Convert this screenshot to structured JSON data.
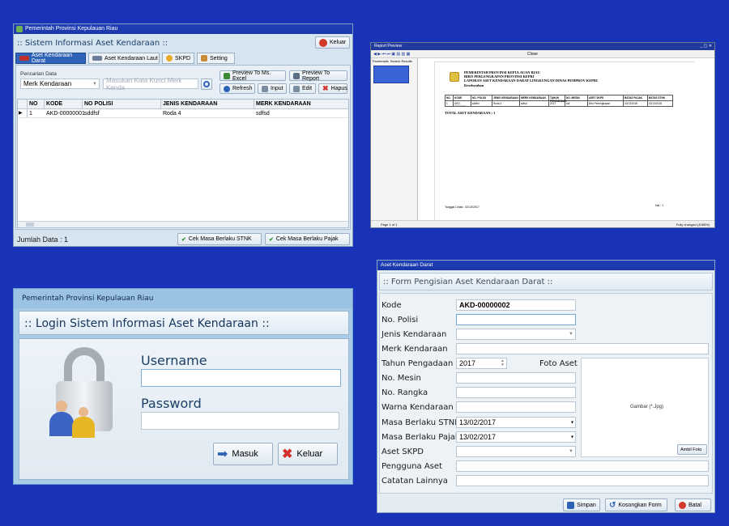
{
  "main_window": {
    "title": "Pemerintah Provinsi Kepulauan Riau",
    "header": ":: Sistem Informasi Aset Kendaraan ::",
    "keluar_label": "Keluar",
    "tabs": [
      "Aset Kendaraan Darat",
      "Aset Kendaraan Laut",
      "SKPD",
      "Setting"
    ],
    "search_label": "Pencarian Data",
    "search_field_value": "Merk Kendaraan",
    "search_placeholder": "Masukan Kata Kunci Merk Kenda",
    "buttons": {
      "preview_excel": "Preview To Ms. Excel",
      "preview_report": "Preview To Report",
      "refresh": "Refresh",
      "input": "Input",
      "edit": "Edit",
      "hapus": "Hapus"
    },
    "table": {
      "columns": [
        "NO",
        "KODE",
        "NO POLISI",
        "JENIS KENDARAAN",
        "MERK KENDARAAN"
      ],
      "rows": [
        {
          "no": "1",
          "kode": "AKD-00000001",
          "no_polisi": "sddfsf",
          "jenis": "Roda 4",
          "merk": "sdfsd"
        }
      ]
    },
    "jumlah_data": "Jumlah Data : 1",
    "cek_stnk": "Cek Masa Berlaku STNK",
    "cek_pajak": "Cek Masa Berlaku Pajak"
  },
  "report_window": {
    "title": "Report Preview",
    "tab_thumbnails": "Thumbnails",
    "tab_search": "Search Results",
    "close_label": "Close",
    "header_lines": [
      "PEMERINTAH PROVINSI KEPULAUAN RIAU",
      "BIRO PERLENGKAPAN PROVINSI KEPRI",
      "LAPORAN ASET KENDARAAN DARAT LINGKUNGAN DINAS PEMPROV KEPRI",
      "Keseluruhan"
    ],
    "columns": [
      "NO.",
      "KODE",
      "NO. POLISI",
      "JENIS KENDARAAN",
      "MERK KENDARAAN",
      "TAHUN PENGADAAN",
      "NO. MESIN",
      "ASET SKPD",
      "BATAS PAJAK",
      "BATAS STNK"
    ],
    "row": [
      "1",
      "AKD-00000001",
      "sddfsf",
      "Roda 4",
      "sdfsd",
      "2017",
      "sdf",
      "Biro Perlengkapan",
      "02/13/2018",
      "02/13/2018"
    ],
    "total": "TOTAL ASET KENDARAAN : 1",
    "tanggal": "Tanggal Cetak : 02/13/2017",
    "hal": "Hal : 1",
    "page_status": "Page 1 of 1",
    "zoom_status": "Fully changed (1085%)"
  },
  "login_window": {
    "title": "Pemerintah Provinsi Kepulauan Riau",
    "header": ":: Login Sistem Informasi Aset Kendaraan ::",
    "username_label": "Username",
    "password_label": "Password",
    "masuk_label": "Masuk",
    "keluar_label": "Keluar"
  },
  "form_window": {
    "title": "Aset Kendaraan Darat",
    "header": ":: Form Pengisian Aset Kendaraan Darat ::",
    "labels": {
      "kode": "Kode",
      "no_polisi": "No. Polisi",
      "jenis": "Jenis Kendaraan",
      "merk": "Merk Kendaraan",
      "tahun": "Tahun Pengadaan",
      "foto": "Foto Aset",
      "mesin": "No. Mesin",
      "rangka": "No. Rangka",
      "warna": "Warna Kendaraan",
      "stnk": "Masa Berlaku STNK",
      "pajak": "Masa Berlaku Pajak",
      "skpd": "Aset SKPD",
      "pengguna": "Pengguna Aset",
      "catatan": "Catatan Lainnya"
    },
    "values": {
      "kode": "AKD-00000002",
      "tahun": "2017",
      "stnk": "13/02/2017",
      "pajak": "13/02/2017"
    },
    "gambar": "Gambar (*.Jpg)",
    "ambil_foto": "Ambil Foto",
    "simpan": "Simpan",
    "kosongkan": "Kosongkan Form",
    "batal": "Batal"
  }
}
